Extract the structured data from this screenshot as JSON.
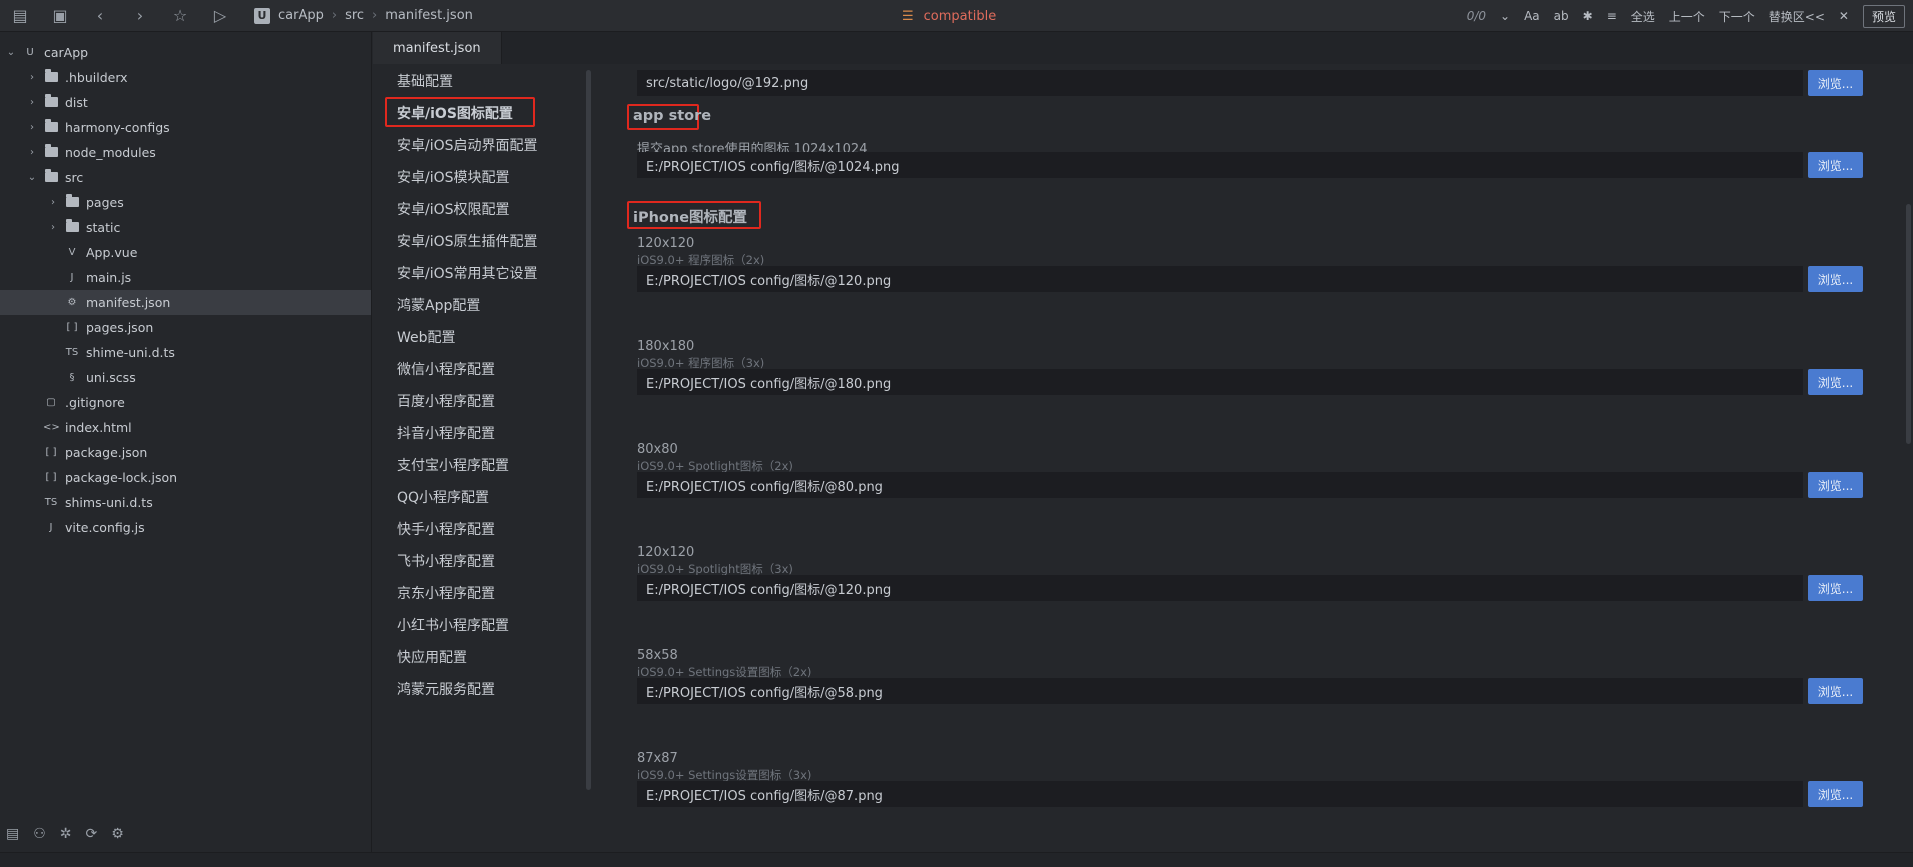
{
  "toolbar": {
    "breadcrumb": [
      "carApp",
      "src",
      "manifest.json"
    ],
    "search_text": "compatible",
    "match_count": "0/0",
    "right_items": [
      "Aa",
      "全选",
      "上一个",
      "下一个",
      "替换区<<"
    ],
    "preview_label": "预览"
  },
  "file_tree": [
    {
      "label": "carApp",
      "icon": "project-icon",
      "depth": 0,
      "expanded": true,
      "arrow": "v"
    },
    {
      "label": ".hbuilderx",
      "icon": "folder-icon",
      "depth": 1,
      "arrow": ">"
    },
    {
      "label": "dist",
      "icon": "folder-icon",
      "depth": 1,
      "arrow": ">"
    },
    {
      "label": "harmony-configs",
      "icon": "folder-icon",
      "depth": 1,
      "arrow": ">"
    },
    {
      "label": "node_modules",
      "icon": "folder-icon",
      "depth": 1,
      "arrow": ">"
    },
    {
      "label": "src",
      "icon": "folder-open-icon",
      "depth": 1,
      "arrow": "v"
    },
    {
      "label": "pages",
      "icon": "folder-icon",
      "depth": 2,
      "arrow": ">"
    },
    {
      "label": "static",
      "icon": "folder-icon",
      "depth": 2,
      "arrow": ">"
    },
    {
      "label": "App.vue",
      "icon": "vue-file-icon",
      "depth": 2
    },
    {
      "label": "main.js",
      "icon": "js-file-icon",
      "depth": 2
    },
    {
      "label": "manifest.json",
      "icon": "manifest-file-icon",
      "depth": 2,
      "selected": true
    },
    {
      "label": "pages.json",
      "icon": "json-file-icon",
      "depth": 2
    },
    {
      "label": "shime-uni.d.ts",
      "icon": "ts-file-icon",
      "depth": 2
    },
    {
      "label": "uni.scss",
      "icon": "scss-file-icon",
      "depth": 2
    },
    {
      "label": ".gitignore",
      "icon": "file-icon",
      "depth": 1
    },
    {
      "label": "index.html",
      "icon": "html-file-icon",
      "depth": 1
    },
    {
      "label": "package.json",
      "icon": "json-file-icon",
      "depth": 1
    },
    {
      "label": "package-lock.json",
      "icon": "json-file-icon",
      "depth": 1
    },
    {
      "label": "shims-uni.d.ts",
      "icon": "ts-file-icon",
      "depth": 1
    },
    {
      "label": "vite.config.js",
      "icon": "js-file-icon",
      "depth": 1
    }
  ],
  "editor_tab": "manifest.json",
  "config_nav": {
    "items": [
      "基础配置",
      "安卓/iOS图标配置",
      "安卓/iOS启动界面配置",
      "安卓/iOS模块配置",
      "安卓/iOS权限配置",
      "安卓/iOS原生插件配置",
      "安卓/iOS常用其它设置",
      "鸿蒙App配置",
      "Web配置",
      "微信小程序配置",
      "百度小程序配置",
      "抖音小程序配置",
      "支付宝小程序配置",
      "QQ小程序配置",
      "快手小程序配置",
      "飞书小程序配置",
      "京东小程序配置",
      "小红书小程序配置",
      "快应用配置",
      "鸿蒙元服务配置"
    ],
    "active_index": 1
  },
  "content": {
    "browse_label": "浏览...",
    "top_path": "src/static/logo/@192.png",
    "app_store": {
      "title": "app store",
      "label": "提交app store使用的图标 1024x1024",
      "path": "E:/PROJECT/IOS config/图标/@1024.png"
    },
    "iphone": {
      "title": "iPhone图标配置",
      "fields": [
        {
          "label": "120x120",
          "sub": "iOS9.0+ 程序图标（2x)",
          "path": "E:/PROJECT/IOS config/图标/@120.png"
        },
        {
          "label": "180x180",
          "sub": "iOS9.0+ 程序图标（3x)",
          "path": "E:/PROJECT/IOS config/图标/@180.png"
        },
        {
          "label": "80x80",
          "sub": "iOS9.0+ Spotlight图标（2x)",
          "path": "E:/PROJECT/IOS config/图标/@80.png"
        },
        {
          "label": "120x120",
          "sub": "iOS9.0+ Spotlight图标（3x)",
          "path": "E:/PROJECT/IOS config/图标/@120.png"
        },
        {
          "label": "58x58",
          "sub": "iOS9.0+ Settings设置图标（2x)",
          "path": "E:/PROJECT/IOS config/图标/@58.png"
        },
        {
          "label": "87x87",
          "sub": "iOS9.0+ Settings设置图标（3x)",
          "path": "E:/PROJECT/IOS config/图标/@87.png"
        }
      ]
    }
  }
}
